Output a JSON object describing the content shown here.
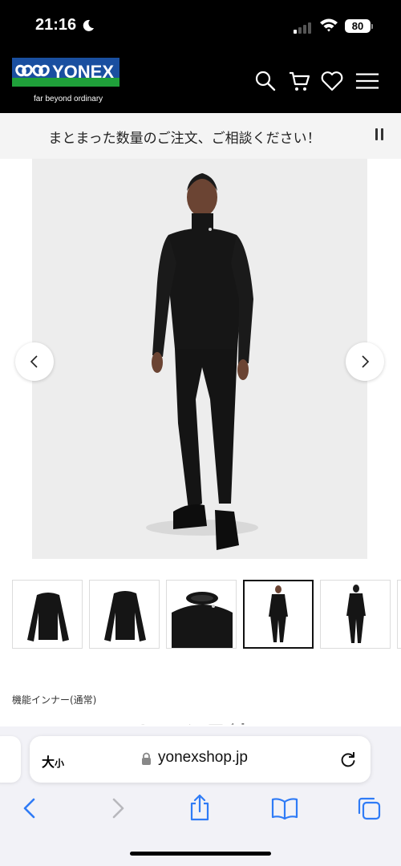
{
  "status_bar": {
    "time": "21:16",
    "battery": "80"
  },
  "header": {
    "logo_text": "YONEX",
    "tagline": "far beyond ordinary",
    "icons": [
      "search-icon",
      "cart-icon",
      "heart-icon",
      "menu-icon"
    ]
  },
  "announcement": {
    "text": "まとまった数量のご注文、ご相談ください！"
  },
  "product": {
    "category": "機能インナー(通常)",
    "title_partial": "フローレイネック長袖シャ",
    "thumbnails": [
      "front-view",
      "back-view",
      "collar-closeup",
      "full-body-front",
      "full-body-back"
    ],
    "selected_thumbnail_index": 3
  },
  "browser": {
    "text_size_label": "大",
    "text_size_small": "小",
    "url": "yonexshop.jp"
  },
  "colors": {
    "brand_blue": "#1a4fa0",
    "brand_green": "#1fa03a",
    "ios_blue": "#2f7bf6"
  }
}
